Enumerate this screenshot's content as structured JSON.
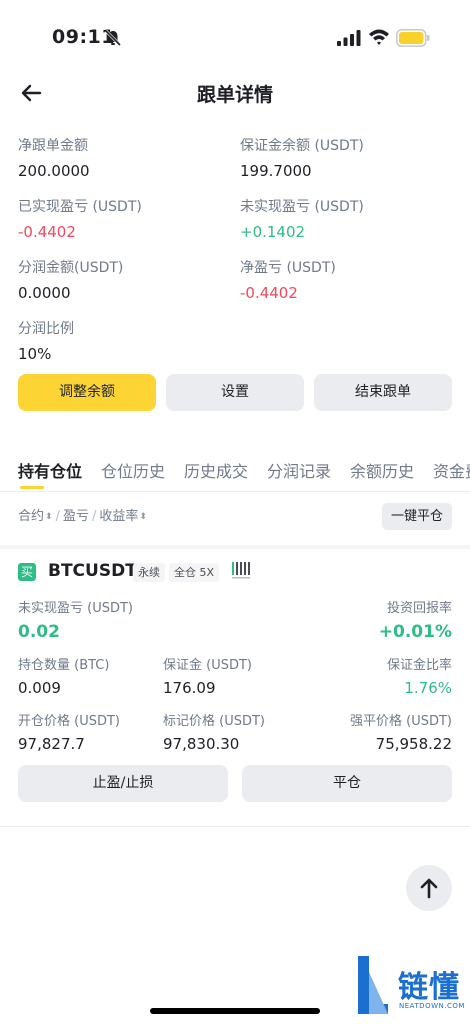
{
  "status_bar": {
    "time": "09:11"
  },
  "nav": {
    "title": "跟单详情"
  },
  "summary": {
    "net_copy_amount": {
      "label": "净跟单金额",
      "value": "200.0000"
    },
    "margin_balance": {
      "label": "保证金余额 (USDT)",
      "value": "199.7000"
    },
    "realized_pnl": {
      "label": "已实现盈亏 (USDT)",
      "value": "-0.4402"
    },
    "unrealized_pnl": {
      "label": "未实现盈亏 (USDT)",
      "value": "+0.1402"
    },
    "profit_share_amount": {
      "label": "分润金额(USDT)",
      "value": "0.0000"
    },
    "net_pnl": {
      "label": "净盈亏 (USDT)",
      "value": "-0.4402"
    },
    "profit_share_ratio": {
      "label": "分润比例",
      "value": "10%"
    }
  },
  "actions": {
    "adjust_balance": "调整余额",
    "settings": "设置",
    "end_copy": "结束跟单"
  },
  "tabs": [
    "持有仓位",
    "仓位历史",
    "历史成交",
    "分润记录",
    "余额历史",
    "资金费"
  ],
  "sort": {
    "contract": "合约",
    "pnl": "盈亏",
    "roi": "收益率",
    "close_all": "一键平仓"
  },
  "position": {
    "side_badge": "买",
    "symbol": "BTCUSDT",
    "type_tag": "永续",
    "margin_tag": "全仓 5X",
    "unrealized_pnl_label": "未实现盈亏 (USDT)",
    "unrealized_pnl": "0.02",
    "roi_label": "投资回报率",
    "roi": "+0.01%",
    "size_label": "持仓数量 (BTC)",
    "size": "0.009",
    "margin_label": "保证金 (USDT)",
    "margin": "176.09",
    "margin_ratio_label": "保证金比率",
    "margin_ratio": "1.76%",
    "entry_label": "开仓价格 (USDT)",
    "entry": "97,827.7",
    "mark_label": "标记价格 (USDT)",
    "mark": "97,830.30",
    "liq_label": "强平价格 (USDT)",
    "liq": "75,958.22",
    "tpsl_button": "止盈/止损",
    "close_button": "平仓"
  },
  "watermark": {
    "text": "链懂",
    "sub": "NEATDOWN.COM"
  },
  "colors": {
    "accent": "#fcd535",
    "up": "#2ebd85",
    "down": "#f6465d",
    "muted": "#707a8a"
  }
}
